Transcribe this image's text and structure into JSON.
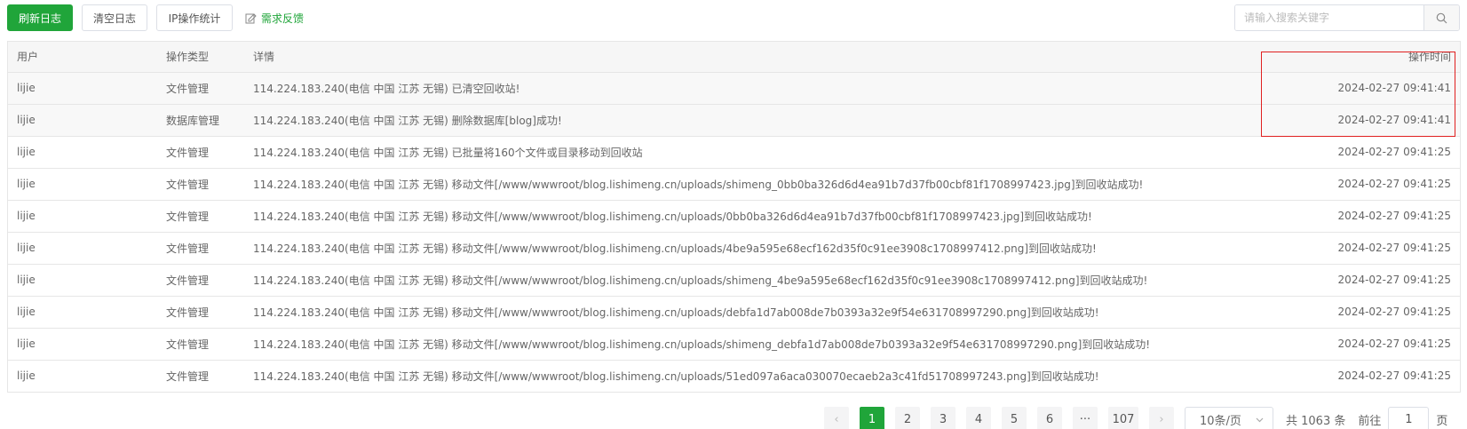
{
  "toolbar": {
    "refresh_label": "刷新日志",
    "clear_label": "清空日志",
    "ip_stats_label": "IP操作统计",
    "feedback_label": "需求反馈",
    "search_placeholder": "请输入搜索关键字"
  },
  "colors": {
    "primary": "#20a53a",
    "highlight": "#e02020"
  },
  "table": {
    "headers": {
      "user": "用户",
      "type": "操作类型",
      "detail": "详情",
      "time": "操作时间"
    },
    "rows": [
      {
        "user": "lijie",
        "type": "文件管理",
        "detail": "114.224.183.240(电信 中国 江苏 无锡) 已清空回收站!",
        "time": "2024-02-27 09:41:41"
      },
      {
        "user": "lijie",
        "type": "数据库管理",
        "detail": "114.224.183.240(电信 中国 江苏 无锡) 删除数据库[blog]成功!",
        "time": "2024-02-27 09:41:41"
      },
      {
        "user": "lijie",
        "type": "文件管理",
        "detail": "114.224.183.240(电信 中国 江苏 无锡) 已批量将160个文件或目录移动到回收站",
        "time": "2024-02-27 09:41:25"
      },
      {
        "user": "lijie",
        "type": "文件管理",
        "detail": "114.224.183.240(电信 中国 江苏 无锡) 移动文件[/www/wwwroot/blog.lishimeng.cn/uploads/shimeng_0bb0ba326d6d4ea91b7d37fb00cbf81f1708997423.jpg]到回收站成功!",
        "time": "2024-02-27 09:41:25"
      },
      {
        "user": "lijie",
        "type": "文件管理",
        "detail": "114.224.183.240(电信 中国 江苏 无锡) 移动文件[/www/wwwroot/blog.lishimeng.cn/uploads/0bb0ba326d6d4ea91b7d37fb00cbf81f1708997423.jpg]到回收站成功!",
        "time": "2024-02-27 09:41:25"
      },
      {
        "user": "lijie",
        "type": "文件管理",
        "detail": "114.224.183.240(电信 中国 江苏 无锡) 移动文件[/www/wwwroot/blog.lishimeng.cn/uploads/4be9a595e68ecf162d35f0c91ee3908c1708997412.png]到回收站成功!",
        "time": "2024-02-27 09:41:25"
      },
      {
        "user": "lijie",
        "type": "文件管理",
        "detail": "114.224.183.240(电信 中国 江苏 无锡) 移动文件[/www/wwwroot/blog.lishimeng.cn/uploads/shimeng_4be9a595e68ecf162d35f0c91ee3908c1708997412.png]到回收站成功!",
        "time": "2024-02-27 09:41:25"
      },
      {
        "user": "lijie",
        "type": "文件管理",
        "detail": "114.224.183.240(电信 中国 江苏 无锡) 移动文件[/www/wwwroot/blog.lishimeng.cn/uploads/debfa1d7ab008de7b0393a32e9f54e631708997290.png]到回收站成功!",
        "time": "2024-02-27 09:41:25"
      },
      {
        "user": "lijie",
        "type": "文件管理",
        "detail": "114.224.183.240(电信 中国 江苏 无锡) 移动文件[/www/wwwroot/blog.lishimeng.cn/uploads/shimeng_debfa1d7ab008de7b0393a32e9f54e631708997290.png]到回收站成功!",
        "time": "2024-02-27 09:41:25"
      },
      {
        "user": "lijie",
        "type": "文件管理",
        "detail": "114.224.183.240(电信 中国 江苏 无锡) 移动文件[/www/wwwroot/blog.lishimeng.cn/uploads/51ed097a6aca030070ecaeb2a3c41fd51708997243.png]到回收站成功!",
        "time": "2024-02-27 09:41:25"
      }
    ]
  },
  "pagination": {
    "prev": "‹",
    "next": "›",
    "pages": [
      "1",
      "2",
      "3",
      "4",
      "5",
      "6"
    ],
    "ellipsis": "···",
    "last": "107",
    "current": "1",
    "page_size": "10条/页",
    "total": "共 1063 条",
    "goto_label": "前往",
    "goto_value": "1",
    "goto_suffix": "页"
  }
}
